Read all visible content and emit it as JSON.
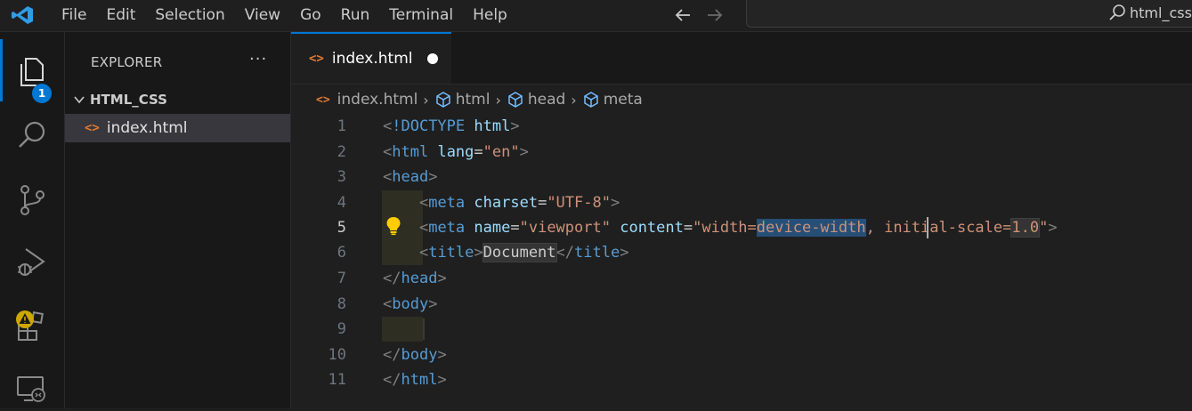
{
  "menu": [
    "File",
    "Edit",
    "Selection",
    "View",
    "Go",
    "Run",
    "Terminal",
    "Help"
  ],
  "command_center": {
    "text": "html_css"
  },
  "activity": {
    "explorer_badge": "1"
  },
  "sidebar": {
    "title": "EXPLORER",
    "more": "···",
    "folder": "HTML_CSS",
    "files": [
      "index.html"
    ]
  },
  "tab": {
    "label": "index.html",
    "icon": "<>"
  },
  "breadcrumb": [
    "index.html",
    "html",
    "head",
    "meta"
  ],
  "editor": {
    "active_line": 5,
    "lines": [
      {
        "n": "1"
      },
      {
        "n": "2"
      },
      {
        "n": "3"
      },
      {
        "n": "4"
      },
      {
        "n": "5"
      },
      {
        "n": "6"
      },
      {
        "n": "7"
      },
      {
        "n": "8"
      },
      {
        "n": "9"
      },
      {
        "n": "10"
      },
      {
        "n": "11"
      }
    ],
    "tokens": {
      "l1_doctype": "!DOCTYPE",
      "l1_html": "html",
      "tag_html": "html",
      "attr_lang": "lang",
      "val_en": "\"en\"",
      "tag_head": "head",
      "tag_meta": "meta",
      "attr_charset": "charset",
      "val_utf8": "\"UTF-8\"",
      "attr_name": "name",
      "val_viewport": "\"viewport\"",
      "attr_content": "content",
      "val_content_a": "\"width=",
      "val_content_sel": "device-width",
      "val_content_b": ", initial-scale=",
      "val_content_num": "1.0",
      "val_content_end": "\"",
      "tag_title": "title",
      "text_document": "Document",
      "tag_body": "body"
    }
  },
  "colors": {
    "accent": "#0078d4",
    "tag": "#569cd6",
    "attribute": "#9cdcfe",
    "string": "#ce9178",
    "punctuation": "#808080",
    "html_icon": "#e37933",
    "warning": "#cca700"
  }
}
